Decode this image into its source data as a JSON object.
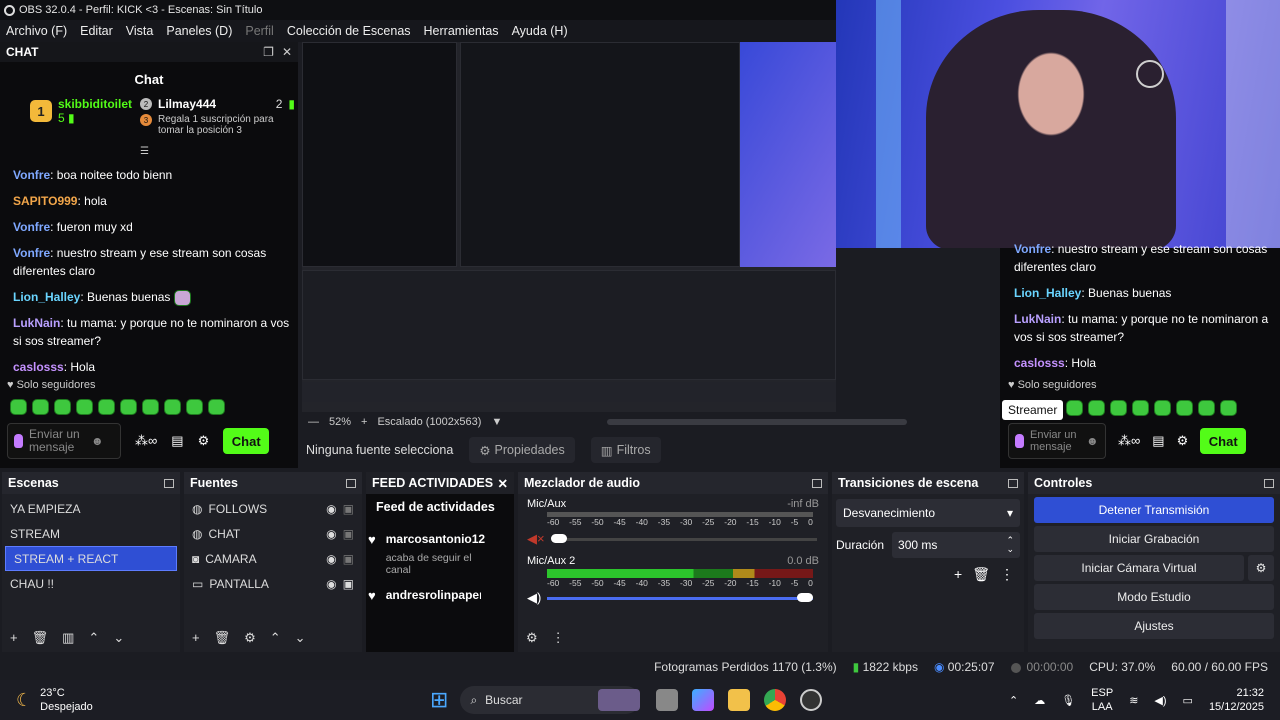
{
  "window": {
    "title": "OBS 32.0.4 - Perfil: KICK <3 - Escenas: Sin Título"
  },
  "menu": [
    "Archivo (F)",
    "Editar",
    "Vista",
    "Paneles (D)",
    "Perfil",
    "Colección de Escenas",
    "Herramientas",
    "Ayuda (H)"
  ],
  "chat": {
    "dock_title": "CHAT",
    "title": "Chat",
    "pinned": {
      "user1": "skibbiditoilet",
      "user1_count": "5",
      "user1_rank": "1",
      "user2": "Lilmay444",
      "user2_count": "2",
      "user2_rank": "2",
      "user3_rank": "3",
      "gift_text": "Regala 1 suscripción para tomar la posición 3"
    },
    "messages": [
      {
        "user": "Vonfre",
        "color": "#7fa8ff",
        "text": "boa noitee todo bienn"
      },
      {
        "user": "SAPITO999",
        "color": "#f2a64a",
        "text": "hola"
      },
      {
        "user": "Vonfre",
        "color": "#7fa8ff",
        "text": "fueron muy xd"
      },
      {
        "user": "Vonfre",
        "color": "#7fa8ff",
        "text": "nuestro stream y ese stream son cosas diferentes claro"
      },
      {
        "user": "Lion_Halley",
        "color": "#6ad5ff",
        "text": "Buenas buenas"
      },
      {
        "user": "LukNain",
        "color": "#b9a0ff",
        "text": "tu mama: y porque no te nominaron a vos si sos streamer?"
      },
      {
        "user": "caslosss",
        "color": "#c592ff",
        "text": "Hola"
      }
    ],
    "followers_only": "Solo seguidores",
    "placeholder": "Enviar un mensaje",
    "send": "Chat"
  },
  "right_chat": {
    "messages": [
      {
        "user": "Vonfre",
        "text": "nuestro stream y ese stream son cosas diferentes claro"
      },
      {
        "user": "Lion_Halley",
        "text": "Buenas buenas"
      },
      {
        "user": "LukNain",
        "text": "tu mama: y porque no te nominaron a vos si sos streamer?"
      },
      {
        "user": "caslosss",
        "text": "Hola"
      }
    ],
    "followers_only": "Solo seguidores",
    "tooltip": "Streamer",
    "placeholder": "Enviar un mensaje",
    "send": "Chat"
  },
  "preview": {
    "zoom": "52%",
    "scale": "Escalado (1002x563)",
    "no_source": "Ninguna fuente selecciona",
    "properties": "Propiedades",
    "filters": "Filtros"
  },
  "scenes": {
    "title": "Escenas",
    "items": [
      "YA EMPIEZA",
      "STREAM",
      "STREAM + REACT",
      "CHAU !!"
    ],
    "selected": 2
  },
  "sources": {
    "title": "Fuentes",
    "items": [
      {
        "name": "FOLLOWS",
        "icon": "globe-icon"
      },
      {
        "name": "CHAT",
        "icon": "globe-icon"
      },
      {
        "name": "CAMARA",
        "icon": "camera-icon"
      },
      {
        "name": "PANTALLA",
        "icon": "monitor-icon"
      }
    ]
  },
  "feed": {
    "title": "FEED ACTIVIDADES",
    "heading": "Feed de actividades",
    "items": [
      {
        "user": "marcosantonio12",
        "text": "acaba de seguir el canal"
      },
      {
        "user": "andresrolinpaper",
        "text": ""
      }
    ]
  },
  "mixer": {
    "title": "Mezclador de audio",
    "channels": [
      {
        "name": "Mic/Aux",
        "db": "-inf dB",
        "muted": true,
        "level": 0.02
      },
      {
        "name": "Mic/Aux 2",
        "db": "0.0 dB",
        "muted": false,
        "level": 1.0
      }
    ],
    "scale": [
      "-60",
      "-55",
      "-50",
      "-45",
      "-40",
      "-35",
      "-30",
      "-25",
      "-20",
      "-15",
      "-10",
      "-5",
      "0"
    ]
  },
  "transitions": {
    "title": "Transiciones de escena",
    "type": "Desvanecimiento",
    "duration_label": "Duración",
    "duration": "300 ms"
  },
  "controls": {
    "title": "Controles",
    "buttons": [
      "Detener Transmisión",
      "Iniciar Grabación",
      "Iniciar Cámara Virtual",
      "Modo Estudio",
      "Ajustes"
    ]
  },
  "status": {
    "dropped": "Fotogramas Perdidos 1170 (1.3%)",
    "kbps": "1822 kbps",
    "stream_time": "00:25:07",
    "rec_time": "00:00:00",
    "cpu": "CPU: 37.0%",
    "fps": "60.00 / 60.00 FPS"
  },
  "taskbar": {
    "temp": "23°C",
    "weather": "Despejado",
    "search": "Buscar",
    "lang1": "ESP",
    "lang2": "LAA",
    "time": "21:32",
    "date": "15/12/2025"
  },
  "colors": {
    "kick_green": "#53fc18",
    "obs_blue": "#2f4fd4"
  }
}
